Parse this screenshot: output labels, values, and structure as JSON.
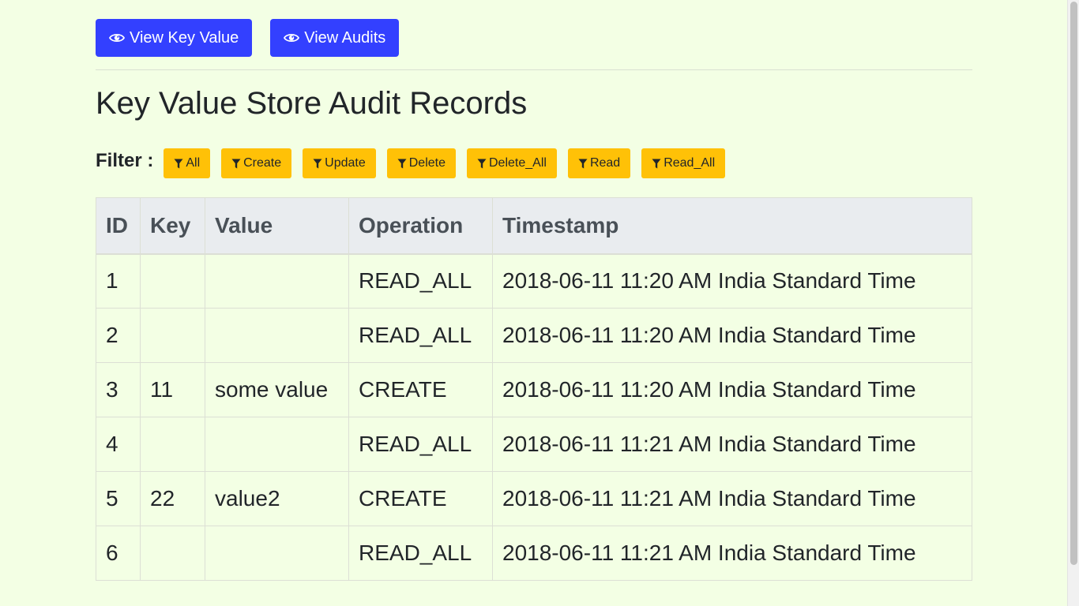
{
  "actions": {
    "view_key_value": {
      "label": "View Key Value",
      "icon": "eye-icon"
    },
    "view_audits": {
      "label": "View Audits",
      "icon": "eye-icon"
    }
  },
  "page_title": "Key Value Store Audit Records",
  "filter": {
    "label": "Filter :",
    "icon": "filter-icon",
    "buttons": [
      "All",
      "Create",
      "Update",
      "Delete",
      "Delete_All",
      "Read",
      "Read_All"
    ]
  },
  "table": {
    "columns": [
      "ID",
      "Key",
      "Value",
      "Operation",
      "Timestamp"
    ],
    "rows": [
      [
        "1",
        "",
        "",
        "READ_ALL",
        "2018-06-11 11:20 AM India Standard Time"
      ],
      [
        "2",
        "",
        "",
        "READ_ALL",
        "2018-06-11 11:20 AM India Standard Time"
      ],
      [
        "3",
        "11",
        "some value",
        "CREATE",
        "2018-06-11 11:20 AM India Standard Time"
      ],
      [
        "4",
        "",
        "",
        "READ_ALL",
        "2018-06-11 11:21 AM India Standard Time"
      ],
      [
        "5",
        "22",
        "value2",
        "CREATE",
        "2018-06-11 11:21 AM India Standard Time"
      ],
      [
        "6",
        "",
        "",
        "READ_ALL",
        "2018-06-11 11:21 AM India Standard Time"
      ]
    ]
  },
  "colors": {
    "background": "#f3ffe4",
    "primary_button": "#3340ff",
    "filter_button": "#ffc107",
    "table_header": "#e9ecef"
  }
}
